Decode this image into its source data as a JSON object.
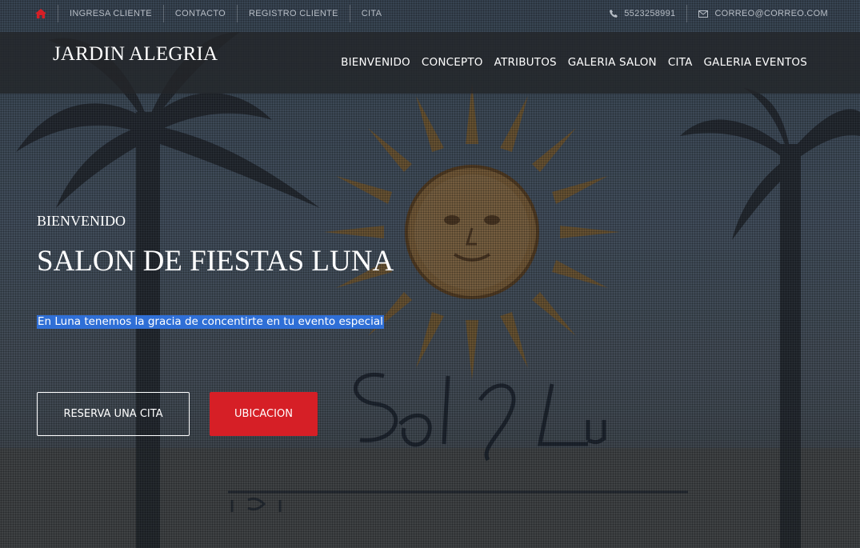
{
  "colors": {
    "accent_red": "#d61f26",
    "highlight_blue": "#2f6fd6",
    "text": "#ffffff",
    "topbar_text": "#b7bdc5"
  },
  "topbar": {
    "home_icon": "home-icon",
    "links": [
      "INGRESA CLIENTE",
      "CONTACTO",
      "REGISTRO CLIENTE",
      "CITA"
    ],
    "phone_icon": "phone-icon",
    "phone": "5523258991",
    "email_icon": "envelope-icon",
    "email": "CORREO@CORREO.COM"
  },
  "navbar": {
    "brand": "JARDIN ALEGRIA",
    "links": [
      "BIENVENIDO",
      "CONCEPTO",
      "ATRIBUTOS",
      "GALERIA SALON",
      "CITA",
      "GALERIA EVENTOS"
    ]
  },
  "hero": {
    "eyebrow": "BIENVENIDO",
    "title": "SALON DE FIESTAS LUNA",
    "subtitle": "En Luna tenemos la gracia de concentirte en tu evento especial",
    "primary_button": "RESERVA UNA CITA",
    "secondary_button": "UBICACION"
  }
}
